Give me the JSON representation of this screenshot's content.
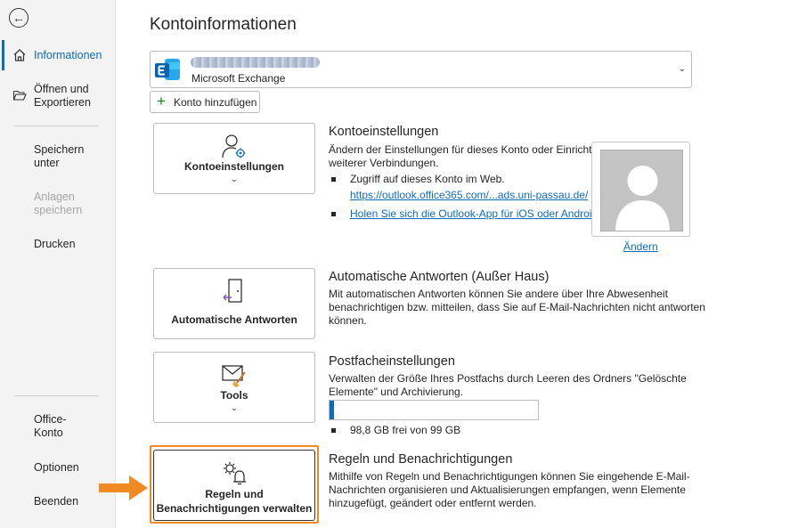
{
  "sidebar": {
    "items": [
      {
        "label": "Informationen"
      },
      {
        "label": "Öffnen und Exportieren"
      },
      {
        "label": "Speichern unter"
      },
      {
        "label": "Anlagen speichern"
      },
      {
        "label": "Drucken"
      },
      {
        "label": "Office-Konto"
      },
      {
        "label": "Optionen"
      },
      {
        "label": "Beenden"
      }
    ]
  },
  "page_title": "Kontoinformationen",
  "account": {
    "type": "Microsoft Exchange",
    "add_label": "Konto hinzufügen"
  },
  "tiles": {
    "account_settings": "Kontoeinstellungen",
    "auto_replies": "Automatische Antworten",
    "tools": "Tools",
    "rules_line1": "Regeln und",
    "rules_line2": "Benachrichtigungen verwalten"
  },
  "sections": {
    "account_settings": {
      "title": "Kontoeinstellungen",
      "text_line1": "Ändern der Einstellungen für dieses Konto oder Einrichten",
      "text_line2": "weiterer Verbindungen.",
      "bullet1": "Zugriff auf dieses Konto im Web.",
      "bullet1_link": "https://outlook.office365.com/...ads.uni-passau.de/",
      "bullet2_link": "Holen Sie sich die Outlook-App für iOS oder Android.",
      "change_link": "Ändern"
    },
    "auto_replies": {
      "title": "Automatische Antworten (Außer Haus)",
      "line1": "Mit automatischen Antworten können Sie andere über Ihre Abwesenheit",
      "line2": "benachrichtigen bzw. mitteilen, dass Sie auf E-Mail-Nachrichten nicht antworten",
      "line3": "können."
    },
    "mailbox": {
      "title": "Postfacheinstellungen",
      "line1": "Verwalten der Größe Ihres Postfachs durch Leeren des Ordners \"Gelöschte",
      "line2": "Elemente\" und Archivierung.",
      "free_text": "98,8 GB frei von 99 GB",
      "used_fraction": 0.012
    },
    "rules": {
      "title": "Regeln und Benachrichtigungen",
      "line1": "Mithilfe von Regeln und Benachrichtigungen können Sie eingehende E-Mail-",
      "line2": "Nachrichten organisieren und Aktualisierungen empfangen, wenn Elemente",
      "line3": "hinzugefügt, geändert oder entfernt werden."
    }
  },
  "colors": {
    "accent": "#0f6cbd",
    "highlight": "#f08a24"
  }
}
